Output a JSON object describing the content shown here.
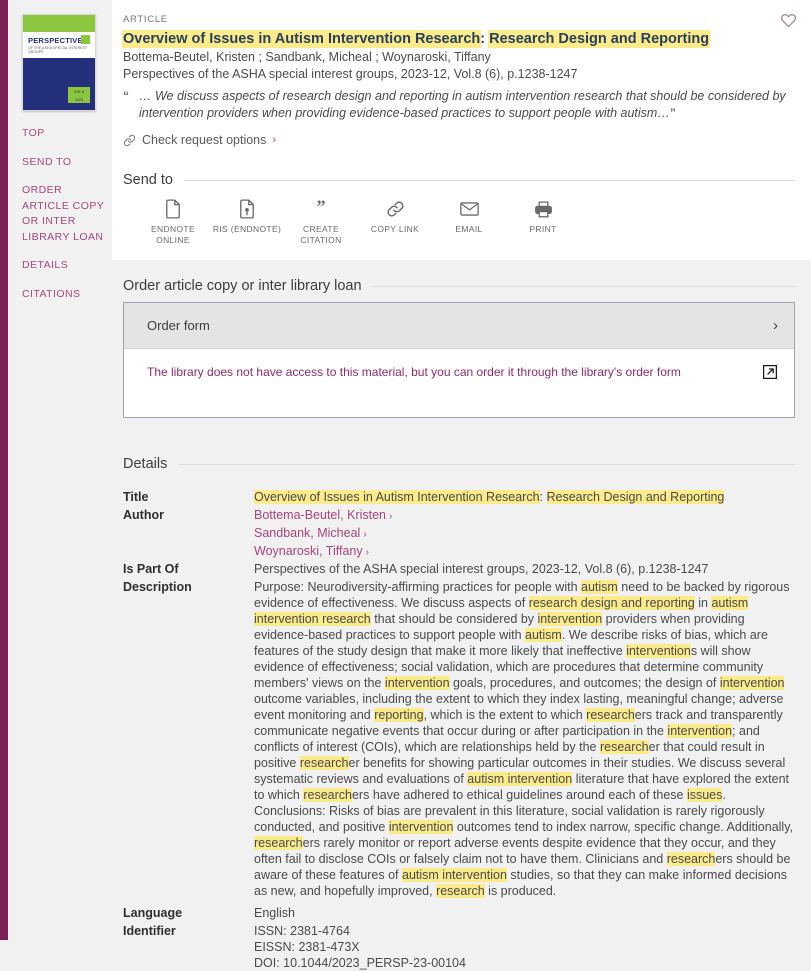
{
  "theme": {
    "accent": "#a8457f",
    "edge_bar": "#7d2257",
    "highlight": "#fbeb8b",
    "title_color": "#28405e",
    "order_msg_color": "#8e2a6e",
    "page_bg": "#f1f1f1"
  },
  "sidebar": {
    "items": [
      {
        "label": "TOP"
      },
      {
        "label": "SEND TO"
      },
      {
        "label": "ORDER ARTICLE COPY OR INTER LIBRARY LOAN"
      },
      {
        "label": "DETAILS"
      },
      {
        "label": "CITATIONS"
      }
    ]
  },
  "cover": {
    "journal_name": "PERSPECTIVES",
    "journal_sub": "OF THE ASHA SPECIAL INTEREST GROUPS",
    "issue_chip_line1": "VOL 8",
    "issue_chip_line2": "2023"
  },
  "record": {
    "kind": "ARTICLE",
    "title_highlighted": "Overview of Issues in Autism Intervention Research",
    "title_rest_prefix": ": ",
    "title_rest_highlighted": "Research Design and Reporting",
    "title_full": "Overview of Issues in Autism Intervention Research: Research Design and Reporting",
    "authors": "Bottema-Beutel, Kristen ; Sandbank, Micheal ; Woynaroski, Tiffany",
    "source": "Perspectives of the ASHA special interest groups, 2023-12, Vol.8 (6), p.1238-1247",
    "snippet": "… We discuss aspects of research design and reporting in autism intervention research that should be considered by intervention providers when providing evidence-based practices to support people with autism…",
    "quote_open": "“",
    "quote_close": "”",
    "request_options_label": "Check request options",
    "request_chevron": "›",
    "favorite_icon": "heart-icon"
  },
  "send_to": {
    "heading": "Send to",
    "actions": [
      {
        "icon": "document-icon",
        "label": "ENDNOTE ONLINE"
      },
      {
        "icon": "ris-file-icon",
        "label": "RIS (ENDNOTE)"
      },
      {
        "icon": "quote-icon",
        "label": "CREATE CITATION"
      },
      {
        "icon": "link-icon",
        "label": "COPY LINK"
      },
      {
        "icon": "envelope-icon",
        "label": "EMAIL"
      },
      {
        "icon": "printer-icon",
        "label": "PRINT"
      }
    ]
  },
  "order": {
    "heading": "Order article copy or inter library loan",
    "form_label": "Order form",
    "form_chevron": "›",
    "message": "The library does not have access to this material, but you can order it through the library's order form",
    "external_icon": "external-link-icon"
  },
  "details": {
    "heading": "Details",
    "fields": {
      "title_label": "Title",
      "title_value_highlighted": "Overview of Issues in Autism Intervention Research",
      "title_value_sep": ": ",
      "title_value_rest": "Research Design and Reporting",
      "author_label": "Author",
      "authors": [
        "Bottema-Beutel, Kristen",
        "Sandbank, Micheal",
        "Woynaroski, Tiffany"
      ],
      "author_chevron": "›",
      "is_part_of_label": "Is Part Of",
      "is_part_of_value": "Perspectives of the ASHA special interest groups, 2023-12, Vol.8 (6), p.1238-1247",
      "description_label": "Description",
      "description_value": "Purpose: Neurodiversity-affirming practices for people with autism need to be backed by rigorous evidence of effectiveness. We discuss aspects of research design and reporting in autism intervention research that should be considered by intervention providers when providing evidence-based practices to support people with autism. We describe risks of bias, which are features of the study design that make it more likely that ineffective interventions will show evidence of effectiveness; social validation, which are procedures that determine community members' views on the intervention goals, procedures, and outcomes; the design of intervention outcome variables, including the extent to which they index lasting, meaningful change; adverse event monitoring and reporting, which is the extent to which researchers track and transparently communicate negative events that occur during or after participation in the intervention; and conflicts of interest (COIs), which are relationships held by the researcher that could result in positive researcher benefits for showing particular outcomes in their studies. We discuss several systematic reviews and evaluations of autism intervention literature that have explored the extent to which researchers have adhered to ethical guidelines around each of these issues. Conclusions: Risks of bias are prevalent in this literature, social validation is rarely rigorously conducted, and positive intervention outcomes tend to index narrow, specific change. Additionally, researchers rarely monitor or report adverse events despite evidence that they occur, and they often fail to disclose COIs or falsely claim not to have them. Clinicians and researchers should be aware of these features of autism intervention studies, so that they can make informed decisions as new, and hopefully improved, research is produced.",
      "language_label": "Language",
      "language_value": "English",
      "identifier_label": "Identifier",
      "identifiers": [
        "ISSN: 2381-4764",
        "EISSN: 2381-473X",
        "DOI: 10.1044/2023_PERSP-23-00104"
      ]
    }
  }
}
